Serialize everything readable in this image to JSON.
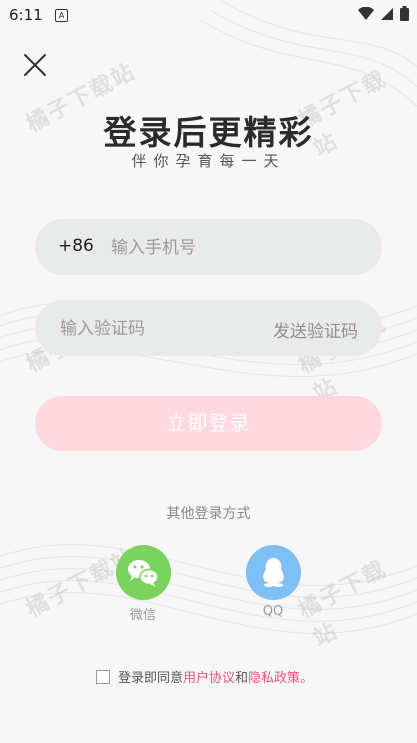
{
  "status_bar": {
    "time": "6:11",
    "app_icon_letter": "A"
  },
  "header": {
    "title": "登录后更精彩",
    "subtitle": "伴你孕育每一天"
  },
  "phone": {
    "country_code": "+86",
    "placeholder": "输入手机号",
    "value": ""
  },
  "code": {
    "placeholder": "输入验证码",
    "value": "",
    "send_label": "发送验证码"
  },
  "login_button": {
    "label": "立即登录"
  },
  "other_login": {
    "label": "其他登录方式",
    "methods": [
      {
        "label": "微信",
        "icon": "wechat-icon",
        "color": "#79d35d"
      },
      {
        "label": "QQ",
        "icon": "qq-icon",
        "color": "#7ebff5"
      }
    ]
  },
  "agreement": {
    "checked": false,
    "prefix": "登录即同意",
    "user_agreement": "用户协议",
    "and": "和",
    "privacy_policy": "隐私政策",
    "suffix": "。"
  },
  "watermark": "橘子下载站",
  "colors": {
    "link": "#e8557a",
    "login_button": "#ffd8e0",
    "input_bg": "#e9ebeb"
  }
}
